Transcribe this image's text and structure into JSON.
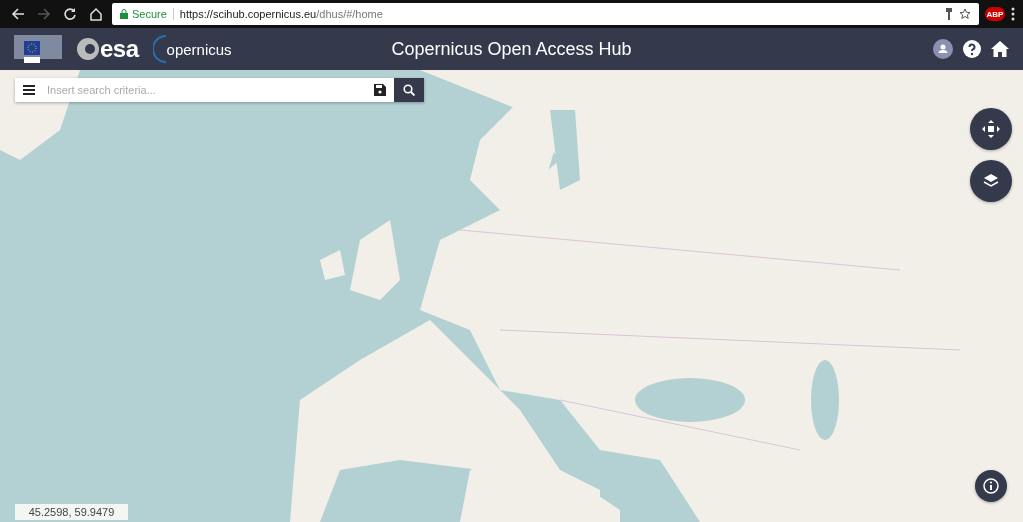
{
  "browser": {
    "secure_label": "Secure",
    "url_host": "https://scihub.copernicus.eu",
    "url_path": "/dhus/#/home",
    "extension_badge": "ABP"
  },
  "header": {
    "esa_logo": "esa",
    "copernicus_logo": "opernicus",
    "title": "Copernicus Open Access Hub"
  },
  "search": {
    "placeholder": "Insert search criteria..."
  },
  "map": {
    "kind": "picture",
    "coordinates": "45.2598, 59.9479"
  }
}
